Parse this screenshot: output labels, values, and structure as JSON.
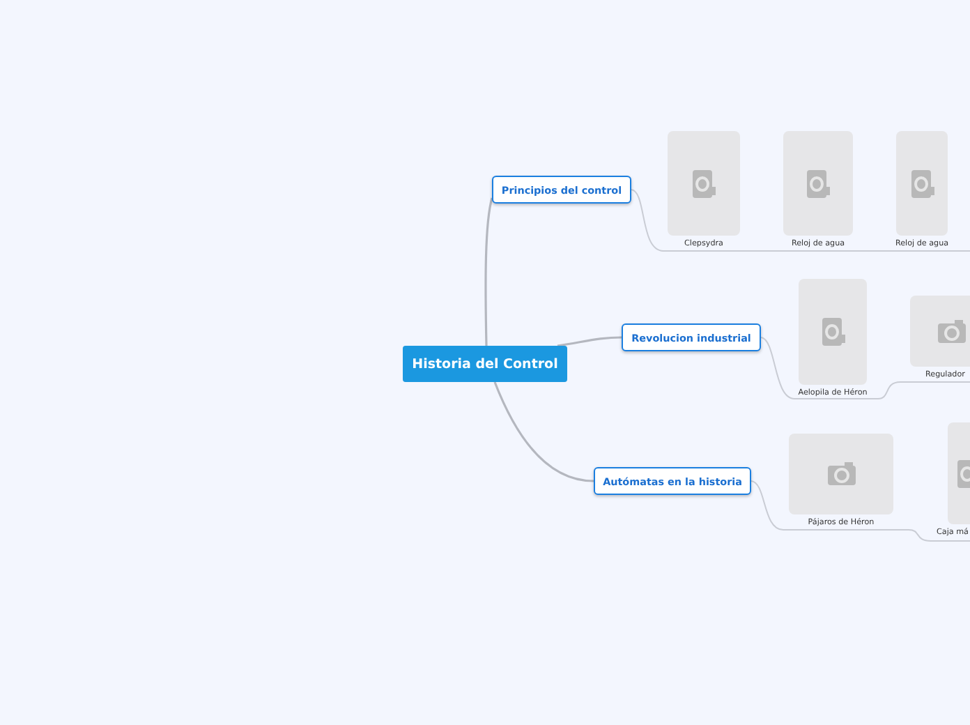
{
  "root": {
    "title": "Historia del Control"
  },
  "branches": [
    {
      "title": "Principios del control",
      "images": [
        {
          "caption": "Clepsydra",
          "kind": "portrait"
        },
        {
          "caption": "Reloj de agua",
          "kind": "portrait"
        },
        {
          "caption": "Reloj de agua",
          "kind": "portrait"
        }
      ]
    },
    {
      "title": "Revolucion industrial",
      "images": [
        {
          "caption": "Aelopila de Héron",
          "kind": "portrait"
        },
        {
          "caption": "Regulador",
          "kind": "landscape"
        }
      ]
    },
    {
      "title": "Autómatas en la historia",
      "images": [
        {
          "caption": "Pájaros de Héron",
          "kind": "landscape"
        },
        {
          "caption": "Caja má",
          "kind": "portrait"
        }
      ]
    }
  ]
}
